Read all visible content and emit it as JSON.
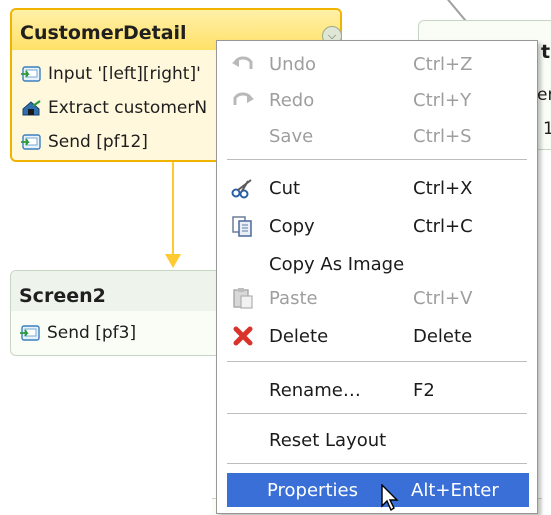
{
  "nodes": {
    "customer_detail": {
      "title": "CustomerDetail",
      "rows": [
        "Input '[left][right]'",
        "Extract customerN",
        "Send [pf12]"
      ]
    },
    "screen2": {
      "title": "Screen2",
      "rows": [
        "Send [pf3]"
      ]
    },
    "right_fragment": {
      "title_frag": "t",
      "row1_frag": "er",
      "row2_frag": "1"
    }
  },
  "menu": {
    "items": [
      {
        "label": "Undo",
        "shortcut": "Ctrl+Z",
        "icon": "undo-icon",
        "enabled": false
      },
      {
        "label": "Redo",
        "shortcut": "Ctrl+Y",
        "icon": "redo-icon",
        "enabled": false
      },
      {
        "label": "Save",
        "shortcut": "Ctrl+S",
        "icon": "",
        "enabled": false
      },
      {
        "label": "Cut",
        "shortcut": "Ctrl+X",
        "icon": "scissors-icon",
        "enabled": true
      },
      {
        "label": "Copy",
        "shortcut": "Ctrl+C",
        "icon": "copy-icon",
        "enabled": true
      },
      {
        "label": "Copy As Image",
        "shortcut": "",
        "icon": "",
        "enabled": true
      },
      {
        "label": "Paste",
        "shortcut": "Ctrl+V",
        "icon": "paste-icon",
        "enabled": false
      },
      {
        "label": "Delete",
        "shortcut": "Delete",
        "icon": "delete-x-icon",
        "enabled": true
      },
      {
        "label": "Rename…",
        "shortcut": "F2",
        "icon": "",
        "enabled": true
      },
      {
        "label": "Reset Layout",
        "shortcut": "",
        "icon": "",
        "enabled": true
      },
      {
        "label": "Properties",
        "shortcut": "Alt+Enter",
        "icon": "",
        "enabled": true,
        "selected": true
      }
    ]
  },
  "colors": {
    "selected_node_border": "#efb300",
    "selection_highlight": "#3a6fd8",
    "connector": "#ffc930",
    "delete_icon": "#d9342b"
  }
}
